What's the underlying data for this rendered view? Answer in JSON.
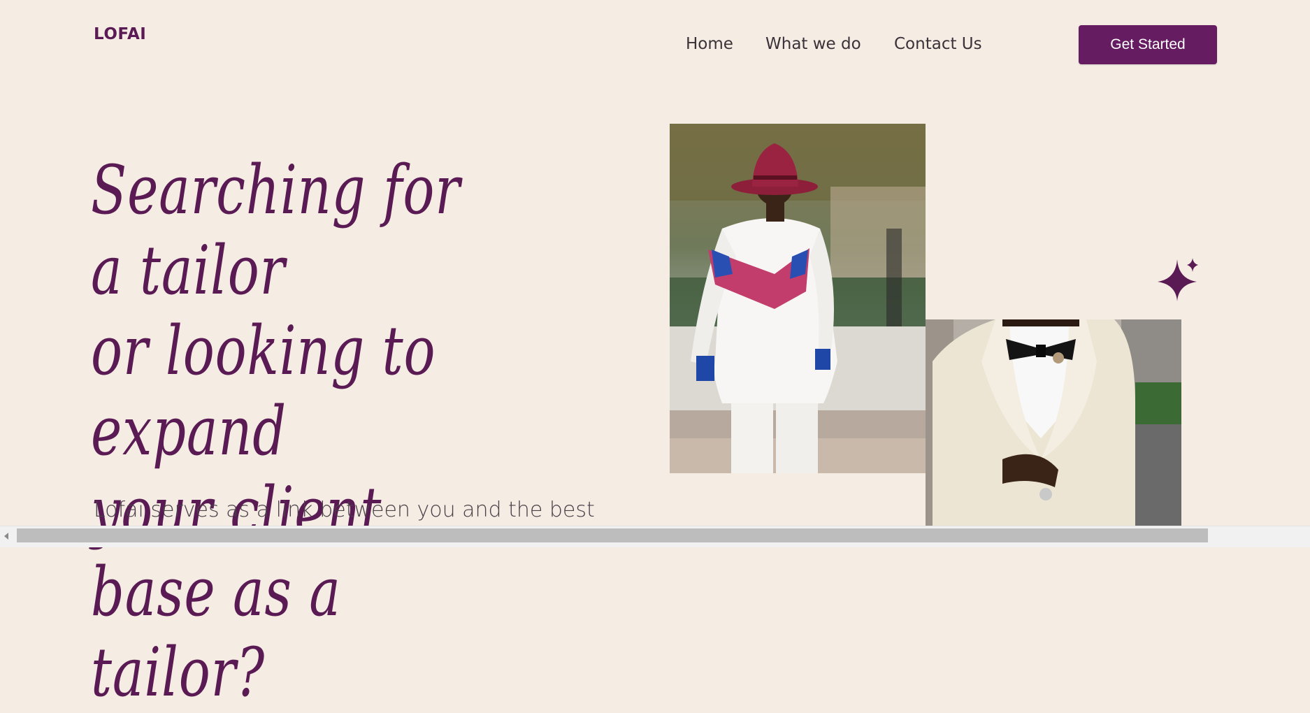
{
  "brand": {
    "logo": "LOFAI"
  },
  "nav": {
    "items": [
      {
        "label": "Home"
      },
      {
        "label": "What we do"
      },
      {
        "label": "Contact Us"
      }
    ],
    "cta_label": "Get Started"
  },
  "hero": {
    "headline_lines": [
      "Searching for a tailor",
      "or looking to expand",
      "your client base as a",
      "tailor?"
    ],
    "subtitle": "Lofai serves as a link between you and the best"
  },
  "colors": {
    "background": "#f5ede4",
    "accent": "#661c61",
    "headline": "#5a1a54"
  },
  "icons": {
    "sparkle": "sparkle-icon",
    "scroll_left": "scroll-left-arrow-icon"
  }
}
